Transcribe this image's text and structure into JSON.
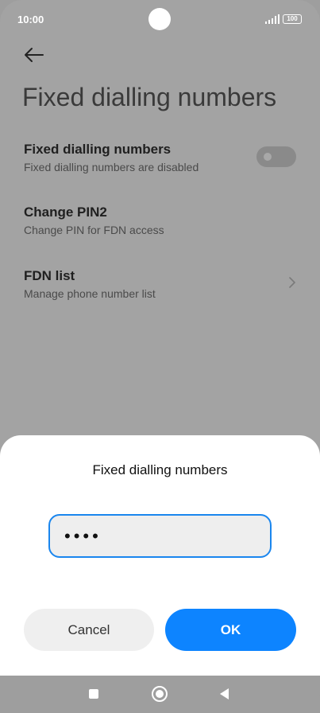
{
  "status_bar": {
    "time": "10:00",
    "battery": "100",
    "signal_icon": "signal-icon",
    "battery_icon": "battery-icon"
  },
  "header": {
    "back_icon": "arrow-left-icon",
    "title": "Fixed dialling numbers"
  },
  "settings": [
    {
      "title": "Fixed dialling numbers",
      "subtitle": "Fixed dialling numbers are disabled",
      "control": "toggle",
      "enabled": false
    },
    {
      "title": "Change PIN2",
      "subtitle": "Change PIN for FDN access"
    },
    {
      "title": "FDN list",
      "subtitle": "Manage phone number list",
      "control": "chevron-right-icon"
    }
  ],
  "dialog": {
    "title": "Fixed dialling numbers",
    "pin_value": "••••",
    "cancel_label": "Cancel",
    "ok_label": "OK",
    "accent_color": "#0d84ff"
  },
  "nav_bar": {
    "recents_icon": "square-icon",
    "home_icon": "home-circle-icon",
    "back_icon": "triangle-back-icon"
  }
}
